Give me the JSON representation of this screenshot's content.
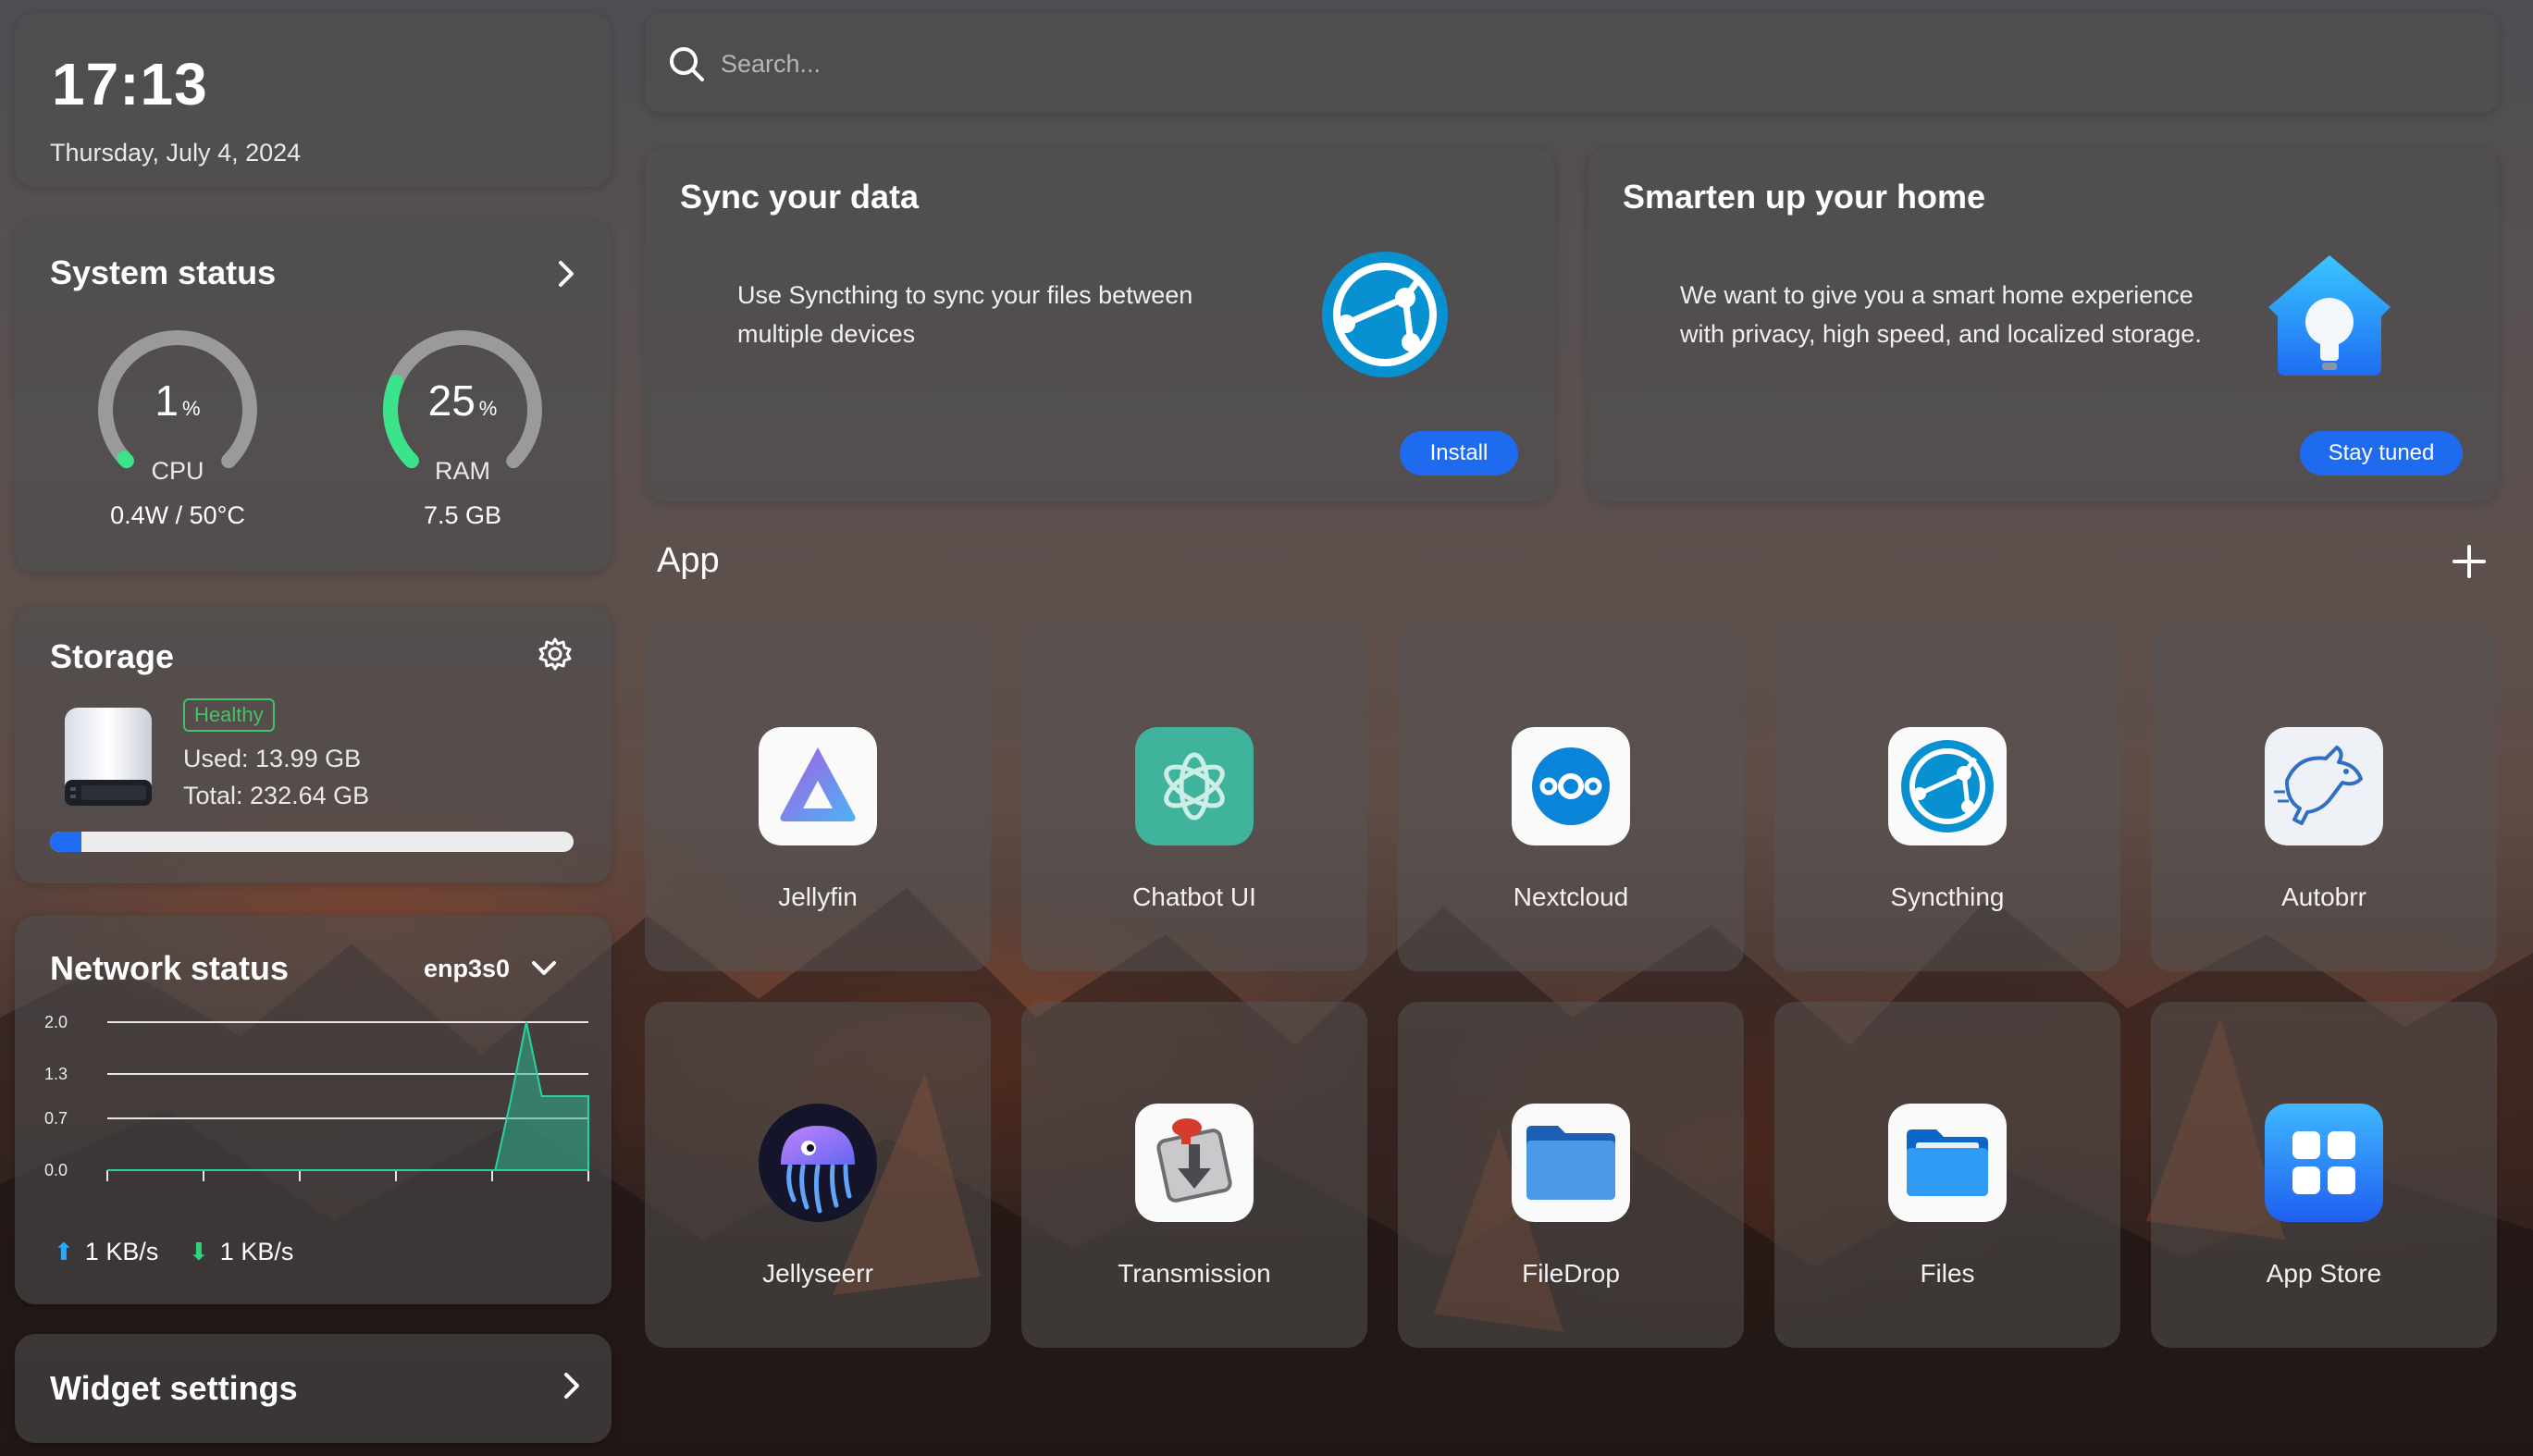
{
  "clock": {
    "time": "17:13",
    "date": "Thursday, July 4, 2024"
  },
  "system_status": {
    "title": "System status",
    "cpu": {
      "value": "1",
      "unit": "%",
      "label": "CPU",
      "detail": "0.4W / 50°C",
      "percent": 1
    },
    "ram": {
      "value": "25",
      "unit": "%",
      "label": "RAM",
      "detail": "7.5 GB",
      "percent": 25
    }
  },
  "storage": {
    "title": "Storage",
    "badge": "Healthy",
    "used": "Used: 13.99 GB",
    "total": "Total: 232.64 GB",
    "used_fraction": 0.06
  },
  "network": {
    "title": "Network status",
    "interface": "enp3s0",
    "upload": "1 KB/s",
    "download": "1 KB/s",
    "chart_data": {
      "type": "area",
      "y_ticks": [
        "2.0",
        "1.3",
        "0.7",
        "0.0"
      ],
      "ylim": [
        0,
        2.0
      ],
      "values": [
        0,
        0,
        0,
        0,
        0,
        0,
        0,
        0,
        0,
        0,
        0,
        0,
        0,
        0,
        0,
        0,
        0,
        0,
        0,
        0,
        0,
        0,
        0,
        0,
        0,
        0,
        0.95,
        2.0,
        1.0,
        1.0,
        1.0,
        1.0
      ]
    }
  },
  "widget_settings": {
    "title": "Widget settings"
  },
  "search": {
    "placeholder": "Search..."
  },
  "promo_sync": {
    "title": "Sync your data",
    "text_line1": "Use Syncthing to sync your files between",
    "text_line2": "multiple devices",
    "button": "Install"
  },
  "promo_home": {
    "title": "Smarten up your home",
    "text_line1": "We want to give you a smart home experience",
    "text_line2": "with privacy, high speed, and localized storage.",
    "button": "Stay tuned"
  },
  "apps_section": {
    "title": "App"
  },
  "apps": [
    {
      "name": "Jellyfin",
      "icon": "jellyfin-icon"
    },
    {
      "name": "Chatbot UI",
      "icon": "chatbot-icon"
    },
    {
      "name": "Nextcloud",
      "icon": "nextcloud-icon"
    },
    {
      "name": "Syncthing",
      "icon": "syncthing-icon"
    },
    {
      "name": "Autobrr",
      "icon": "autobrr-icon"
    },
    {
      "name": "Jellyseerr",
      "icon": "jellyseerr-icon"
    },
    {
      "name": "Transmission",
      "icon": "transmission-icon"
    },
    {
      "name": "FileDrop",
      "icon": "filedrop-icon"
    },
    {
      "name": "Files",
      "icon": "files-icon"
    },
    {
      "name": "App Store",
      "icon": "app-store-icon"
    }
  ],
  "colors": {
    "accent": "#1e6bf0",
    "gauge_green": "#3be38a",
    "healthy": "#46c06a",
    "storage_bar": "#1f6cf2",
    "chart_fill": "#2bb391"
  }
}
